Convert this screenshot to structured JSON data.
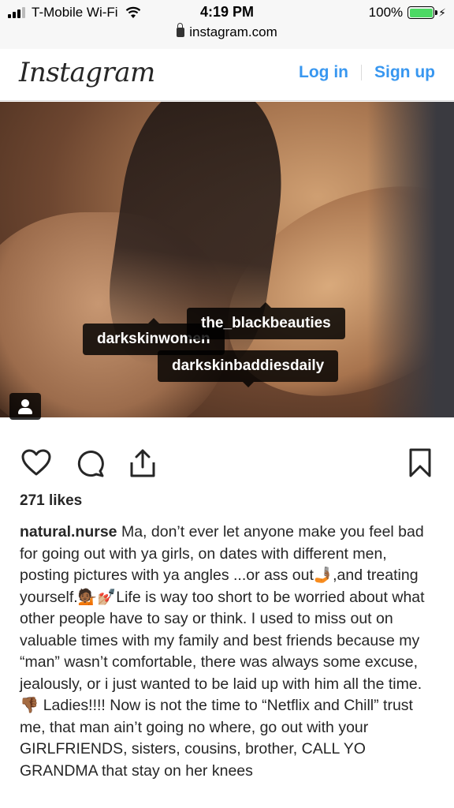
{
  "status_bar": {
    "carrier": "T-Mobile Wi-Fi",
    "time": "4:19 PM",
    "battery": "100%",
    "url": "instagram.com"
  },
  "header": {
    "logo": "Instagram",
    "login_label": "Log in",
    "signup_label": "Sign up"
  },
  "post": {
    "tags": [
      "darkskinwomen",
      "the_blackbeauties",
      "darkskinbaddiesdaily"
    ],
    "likes": "271 likes",
    "username": "natural.nurse",
    "caption": "Ma, don’t ever let anyone make you feel bad for going out with ya girls, on dates with different men, posting pictures with ya angles ...or ass out🤳🏾,and treating yourself.💁🏾💅🏼Life is way too short to be worried about what other people have to say or think. I used to miss out on valuable times with my family and best friends because my “man” wasn’t comfortable, there was always some excuse, jealously, or i just wanted to be laid up with him all the time. 👎🏾 Ladies!!!! Now is not the time to “Netflix and Chill” trust me, that man ain’t going no where, go out with your GIRLFRIENDS, sisters, cousins, brother, CALL YO GRANDMA that stay on her knees"
  },
  "icons": {
    "like": "heart-icon",
    "comment": "comment-icon",
    "share": "share-icon",
    "save": "bookmark-icon",
    "user_tags": "person-icon"
  },
  "colors": {
    "link": "#3897f0",
    "text": "#262626",
    "battery": "#4cd964"
  }
}
